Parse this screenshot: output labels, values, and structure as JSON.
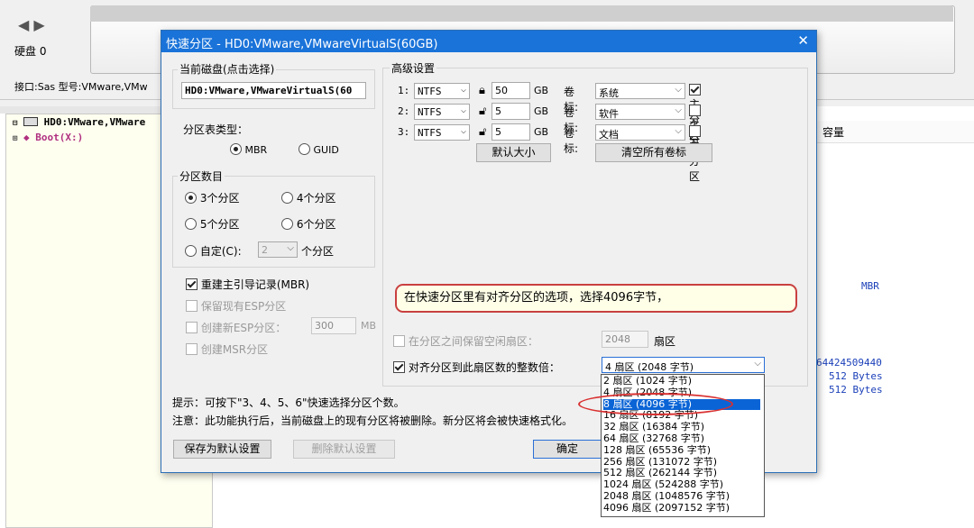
{
  "bg": {
    "disk_label": "硬盘 0",
    "info_line": "接口:Sas  型号:VMware,VMw",
    "tree_disk": "HD0:VMware,VMware",
    "tree_boot": "Boot(X:)",
    "col_capacity": "容量",
    "right_mbr": "MBR",
    "right_val1": "64424509440",
    "right_val2": "512 Bytes",
    "right_val3": "512 Bytes"
  },
  "dialog": {
    "title": "快速分区 - HD0:VMware,VMwareVirtualS(60GB)",
    "close": "✕",
    "current_disk_label": "当前磁盘(点击选择)",
    "current_disk_value": "HD0:VMware,VMwareVirtualS(60",
    "pt_type_label": "分区表类型：",
    "mbr": "MBR",
    "guid": "GUID",
    "count_label": "分区数目",
    "opt3": "3个分区",
    "opt4": "4个分区",
    "opt5": "5个分区",
    "opt6": "6个分区",
    "custom": "自定(C):",
    "custom_value": "2",
    "custom_unit": "个分区",
    "rebuild_mbr": "重建主引导记录(MBR)",
    "keep_esp": "保留现有ESP分区",
    "new_esp": "创建新ESP分区：",
    "esp_size": "300",
    "esp_unit": "MB",
    "create_msr": "创建MSR分区",
    "adv_label": "高级设置",
    "rows": [
      {
        "num": "1:",
        "fs": "NTFS",
        "size": "50",
        "unit": "GB",
        "vol_label": "卷标:",
        "vol": "系统",
        "primary": "主分区",
        "primary_checked": true,
        "locked": true
      },
      {
        "num": "2:",
        "fs": "NTFS",
        "size": "5",
        "unit": "GB",
        "vol_label": "卷标:",
        "vol": "软件",
        "primary": "主分区",
        "primary_checked": false,
        "locked": false
      },
      {
        "num": "3:",
        "fs": "NTFS",
        "size": "5",
        "unit": "GB",
        "vol_label": "卷标:",
        "vol": "文档",
        "primary": "主分区",
        "primary_checked": false,
        "locked": false
      }
    ],
    "default_size_btn": "默认大小",
    "clear_labels_btn": "清空所有卷标",
    "callout": "在快速分区里有对齐分区的选项，选择4096字节，",
    "reserve_label": "在分区之间保留空闲扇区：",
    "reserve_value": "2048",
    "reserve_unit": "扇区",
    "align_label": "对齐分区到此扇区数的整数倍：",
    "align_value": "4 扇区 (2048 字节)",
    "align_options": [
      "2 扇区 (1024 字节)",
      "4 扇区 (2048 字节)",
      "8 扇区 (4096 字节)",
      "16 扇区 (8192 字节)",
      "32 扇区 (16384 字节)",
      "64 扇区 (32768 字节)",
      "128 扇区 (65536 字节)",
      "256 扇区 (131072 字节)",
      "512 扇区 (262144 字节)",
      "1024 扇区 (524288 字节)",
      "2048 扇区 (1048576 字节)",
      "4096 扇区 (2097152 字节)"
    ],
    "align_selected_index": 2,
    "tip": "提示：可按下\"3、4、5、6\"快速选择分区个数。",
    "note": "注意：此功能执行后，当前磁盘上的现有分区将被删除。新分区将会被快速格式化。",
    "save_default_btn": "保存为默认设置",
    "delete_default_btn": "删除默认设置",
    "ok_btn": "确定"
  }
}
